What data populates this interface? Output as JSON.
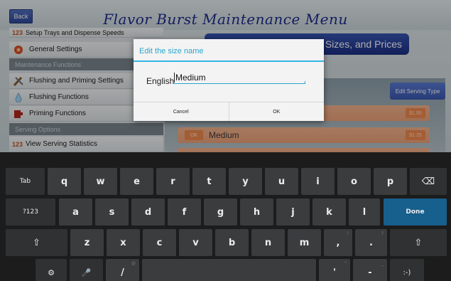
{
  "header": {
    "back_label": "Back",
    "title": "Flavor Burst Maintenance Menu"
  },
  "side_menu": {
    "partial_top": "Setup Trays and Dispense Speeds",
    "general_settings": "General Settings",
    "section_maintenance": "Maintenance Functions",
    "flushing_priming_settings": "Flushing and Priming Settings",
    "flushing_functions": "Flushing Functions",
    "priming_functions": "Priming Functions",
    "section_serving": "Serving Options",
    "view_serving_statistics": "View Serving Statistics"
  },
  "right_panel": {
    "sizes_prices_label": "Sizes, and Prices",
    "edit_serving_type_label": "Edit Serving Type",
    "rows": [
      {
        "ok": "",
        "name": "",
        "price": "$1.00"
      },
      {
        "ok": "OK",
        "name": "Medium",
        "price": "$1.25"
      }
    ]
  },
  "dialog": {
    "title": "Edit the size name",
    "language_label": "English",
    "size_value": "Medium",
    "cancel_label": "Cancel",
    "ok_label": "OK"
  },
  "keyboard": {
    "row1": [
      "Tab",
      "q",
      "w",
      "e",
      "r",
      "t",
      "y",
      "u",
      "i",
      "o",
      "p",
      "⌫"
    ],
    "row2": [
      "?123",
      "a",
      "s",
      "d",
      "f",
      "g",
      "h",
      "j",
      "k",
      "l",
      "Done"
    ],
    "row3": [
      "⇧",
      "z",
      "x",
      "c",
      "v",
      "b",
      "n",
      "m",
      ",",
      ".",
      "⇧"
    ],
    "row3_subs": {
      "comma": "!",
      "period": "?"
    },
    "row4": [
      "⚙",
      "🎤",
      "/",
      "",
      "'",
      "-",
      ":-)"
    ],
    "row4_subs": {
      "slash": "@",
      "apostrophe": "\"",
      "dash": "_"
    }
  }
}
